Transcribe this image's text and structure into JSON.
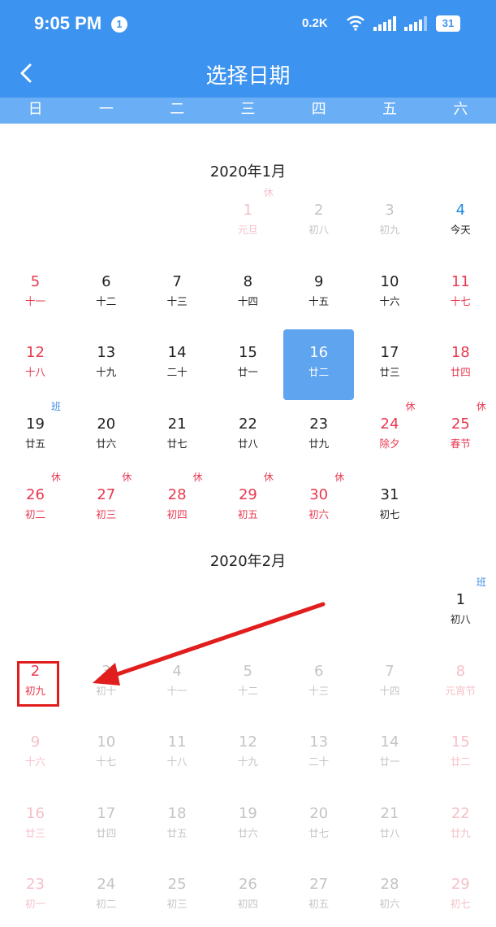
{
  "status_bar": {
    "time": "9:05 PM",
    "notification_count": "1",
    "net_speed": "0.2K",
    "battery": "31",
    "icons": [
      "wifi-icon",
      "signal-icon",
      "signal-icon",
      "battery-icon"
    ]
  },
  "header": {
    "title": "选择日期",
    "back_icon": "chevron-left-icon"
  },
  "weekdays": [
    "日",
    "一",
    "二",
    "三",
    "四",
    "五",
    "六"
  ],
  "months": [
    {
      "title": "2020年1月",
      "days": [
        {
          "num": "1",
          "lunar": "元旦",
          "tag": "休",
          "style": "pink"
        },
        {
          "num": "2",
          "lunar": "初八",
          "tag": "",
          "style": "gray"
        },
        {
          "num": "3",
          "lunar": "初九",
          "tag": "",
          "style": "gray"
        },
        {
          "num": "4",
          "lunar": "今天",
          "tag": "",
          "style": "blue"
        },
        {
          "num": "5",
          "lunar": "十一",
          "tag": "",
          "style": "red"
        },
        {
          "num": "6",
          "lunar": "十二",
          "tag": "",
          "style": "black"
        },
        {
          "num": "7",
          "lunar": "十三",
          "tag": "",
          "style": "black"
        },
        {
          "num": "8",
          "lunar": "十四",
          "tag": "",
          "style": "black"
        },
        {
          "num": "9",
          "lunar": "十五",
          "tag": "",
          "style": "black"
        },
        {
          "num": "10",
          "lunar": "十六",
          "tag": "",
          "style": "black"
        },
        {
          "num": "11",
          "lunar": "十七",
          "tag": "",
          "style": "red"
        },
        {
          "num": "12",
          "lunar": "十八",
          "tag": "",
          "style": "red"
        },
        {
          "num": "13",
          "lunar": "十九",
          "tag": "",
          "style": "black"
        },
        {
          "num": "14",
          "lunar": "二十",
          "tag": "",
          "style": "black"
        },
        {
          "num": "15",
          "lunar": "廿一",
          "tag": "",
          "style": "black"
        },
        {
          "num": "16",
          "lunar": "廿二",
          "tag": "",
          "style": "selected"
        },
        {
          "num": "17",
          "lunar": "廿三",
          "tag": "",
          "style": "black"
        },
        {
          "num": "18",
          "lunar": "廿四",
          "tag": "",
          "style": "red"
        },
        {
          "num": "19",
          "lunar": "廿五",
          "tag": "班",
          "style": "black"
        },
        {
          "num": "20",
          "lunar": "廿六",
          "tag": "",
          "style": "black"
        },
        {
          "num": "21",
          "lunar": "廿七",
          "tag": "",
          "style": "black"
        },
        {
          "num": "22",
          "lunar": "廿八",
          "tag": "",
          "style": "black"
        },
        {
          "num": "23",
          "lunar": "廿九",
          "tag": "",
          "style": "black"
        },
        {
          "num": "24",
          "lunar": "除夕",
          "tag": "休",
          "style": "red"
        },
        {
          "num": "25",
          "lunar": "春节",
          "tag": "休",
          "style": "red"
        },
        {
          "num": "26",
          "lunar": "初二",
          "tag": "休",
          "style": "red"
        },
        {
          "num": "27",
          "lunar": "初三",
          "tag": "休",
          "style": "red"
        },
        {
          "num": "28",
          "lunar": "初四",
          "tag": "休",
          "style": "red"
        },
        {
          "num": "29",
          "lunar": "初五",
          "tag": "休",
          "style": "red"
        },
        {
          "num": "30",
          "lunar": "初六",
          "tag": "休",
          "style": "red"
        },
        {
          "num": "31",
          "lunar": "初七",
          "tag": "",
          "style": "black"
        }
      ]
    },
    {
      "title": "2020年2月",
      "days": [
        {
          "num": "1",
          "lunar": "初八",
          "tag": "班",
          "style": "black"
        },
        {
          "num": "2",
          "lunar": "初九",
          "tag": "",
          "style": "red"
        },
        {
          "num": "3",
          "lunar": "初十",
          "tag": "",
          "style": "gray"
        },
        {
          "num": "4",
          "lunar": "十一",
          "tag": "",
          "style": "gray"
        },
        {
          "num": "5",
          "lunar": "十二",
          "tag": "",
          "style": "gray"
        },
        {
          "num": "6",
          "lunar": "十三",
          "tag": "",
          "style": "gray"
        },
        {
          "num": "7",
          "lunar": "十四",
          "tag": "",
          "style": "gray"
        },
        {
          "num": "8",
          "lunar": "元宵节",
          "tag": "",
          "style": "pink"
        },
        {
          "num": "9",
          "lunar": "十六",
          "tag": "",
          "style": "pink"
        },
        {
          "num": "10",
          "lunar": "十七",
          "tag": "",
          "style": "gray"
        },
        {
          "num": "11",
          "lunar": "十八",
          "tag": "",
          "style": "gray"
        },
        {
          "num": "12",
          "lunar": "十九",
          "tag": "",
          "style": "gray"
        },
        {
          "num": "13",
          "lunar": "二十",
          "tag": "",
          "style": "gray"
        },
        {
          "num": "14",
          "lunar": "廿一",
          "tag": "",
          "style": "gray"
        },
        {
          "num": "15",
          "lunar": "廿二",
          "tag": "",
          "style": "pink"
        },
        {
          "num": "16",
          "lunar": "廿三",
          "tag": "",
          "style": "pink"
        },
        {
          "num": "17",
          "lunar": "廿四",
          "tag": "",
          "style": "gray"
        },
        {
          "num": "18",
          "lunar": "廿五",
          "tag": "",
          "style": "gray"
        },
        {
          "num": "19",
          "lunar": "廿六",
          "tag": "",
          "style": "gray"
        },
        {
          "num": "20",
          "lunar": "廿七",
          "tag": "",
          "style": "gray"
        },
        {
          "num": "21",
          "lunar": "廿八",
          "tag": "",
          "style": "gray"
        },
        {
          "num": "22",
          "lunar": "廿九",
          "tag": "",
          "style": "pink"
        },
        {
          "num": "23",
          "lunar": "初一",
          "tag": "",
          "style": "pink"
        },
        {
          "num": "24",
          "lunar": "初二",
          "tag": "",
          "style": "gray"
        },
        {
          "num": "25",
          "lunar": "初三",
          "tag": "",
          "style": "gray"
        },
        {
          "num": "26",
          "lunar": "初四",
          "tag": "",
          "style": "gray"
        },
        {
          "num": "27",
          "lunar": "初五",
          "tag": "",
          "style": "gray"
        },
        {
          "num": "28",
          "lunar": "初六",
          "tag": "",
          "style": "gray"
        },
        {
          "num": "29",
          "lunar": "初七",
          "tag": "",
          "style": "pink"
        }
      ]
    }
  ],
  "annotation": {
    "box_color": "#e11d1d",
    "arrow_color": "#e11d1d"
  }
}
